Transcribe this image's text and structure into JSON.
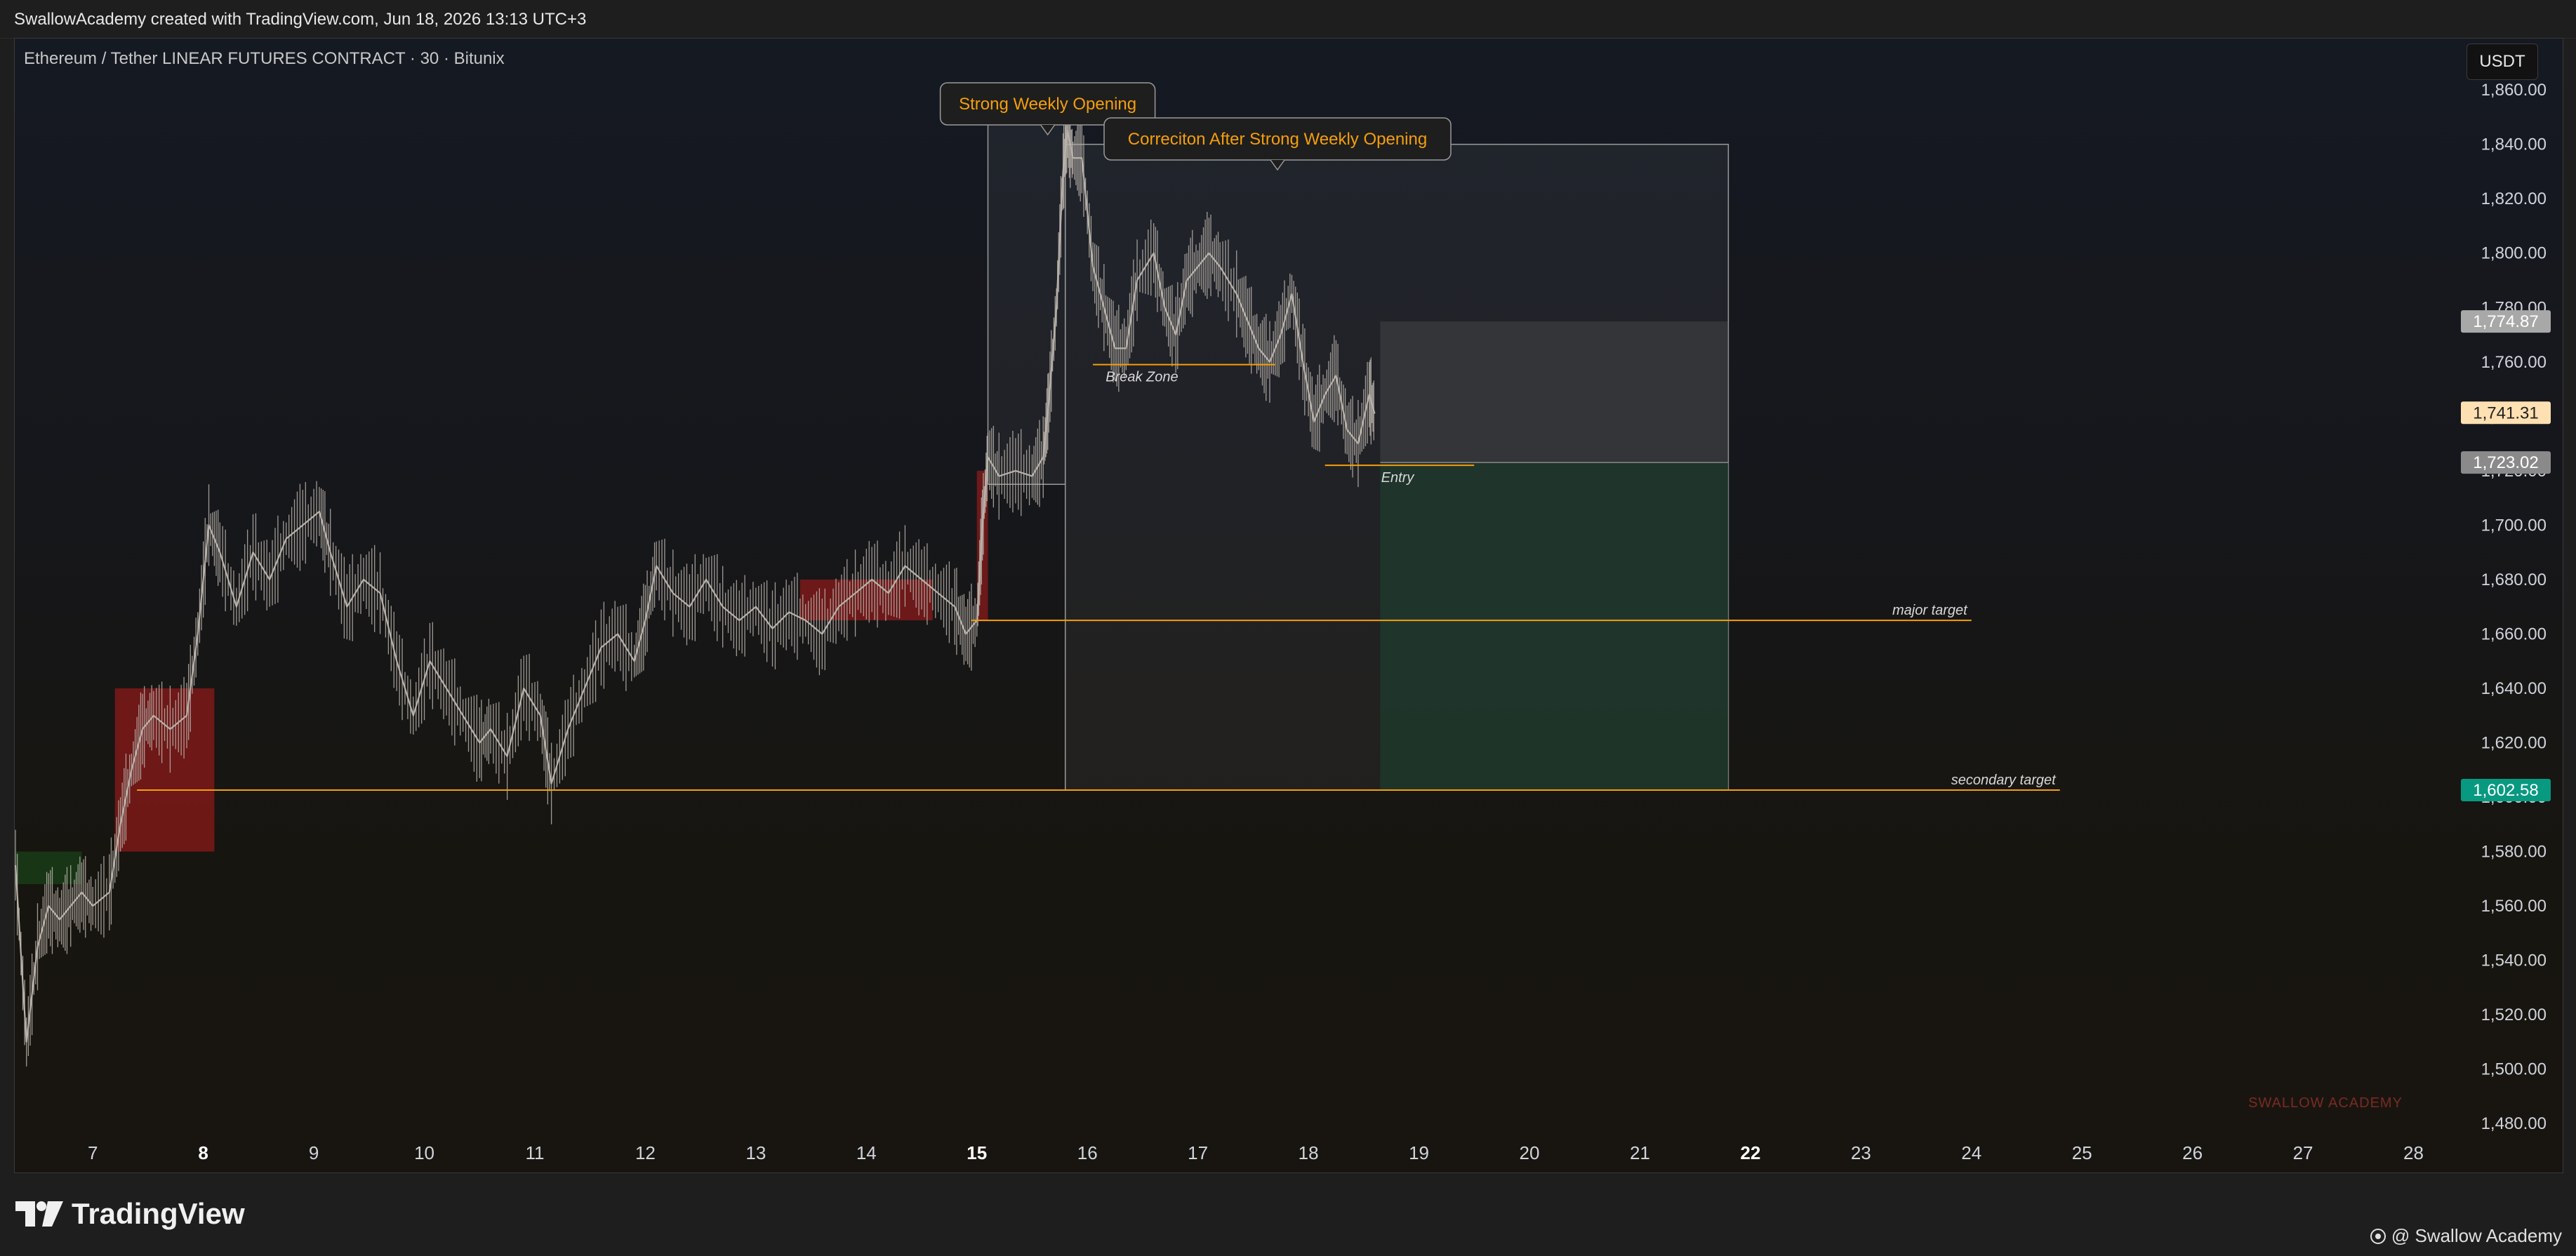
{
  "header": {
    "credit": "SwallowAcademy created with TradingView.com, Jun 18, 2026 13:13 UTC+3",
    "symbol": "Ethereum / Tether LINEAR FUTURES CONTRACT · 30 · Bitunix",
    "currency": "USDT"
  },
  "footer": {
    "logo_text": "TradingView",
    "author": "@ Swallow Academy"
  },
  "chart_data": {
    "type": "candlestick",
    "symbol": "Ethereum / Tether LINEAR FUTURES CONTRACT",
    "timeframe": "30",
    "exchange": "Bitunix",
    "currency": "USDT",
    "ylim": [
      1470,
      1875
    ],
    "y_ticks": [
      1480,
      1500,
      1520,
      1540,
      1560,
      1580,
      1600,
      1620,
      1640,
      1660,
      1680,
      1700,
      1720,
      1740,
      1760,
      1780,
      1800,
      1820,
      1840,
      1860
    ],
    "y_tick_labels": [
      "1,480.00",
      "1,500.00",
      "1,520.00",
      "1,540.00",
      "1,560.00",
      "1,580.00",
      "1,600.00",
      "1,620.00",
      "1,640.00",
      "1,660.00",
      "1,680.00",
      "1,700.00",
      "1,720.00",
      "1,740.00",
      "1,760.00",
      "1,780.00",
      "1,800.00",
      "1,820.00",
      "1,840.00",
      "1,860.00"
    ],
    "xlim": [
      6.3,
      28.2
    ],
    "x_ticks": [
      7,
      8,
      9,
      10,
      11,
      12,
      13,
      14,
      15,
      16,
      17,
      18,
      19,
      20,
      21,
      22,
      23,
      24,
      25,
      26,
      27,
      28
    ],
    "x_tick_labels": [
      "7",
      "8",
      "9",
      "10",
      "11",
      "12",
      "13",
      "14",
      "15",
      "16",
      "17",
      "18",
      "19",
      "20",
      "21",
      "22",
      "23",
      "24",
      "25",
      "26",
      "27",
      "28"
    ],
    "x_bold_ticks": [
      8,
      15,
      22
    ],
    "grid": false,
    "price_path": [
      [
        6.3,
        1575
      ],
      [
        6.4,
        1510
      ],
      [
        6.5,
        1545
      ],
      [
        6.6,
        1560
      ],
      [
        6.7,
        1555
      ],
      [
        6.8,
        1560
      ],
      [
        6.9,
        1565
      ],
      [
        7.0,
        1560
      ],
      [
        7.15,
        1565
      ],
      [
        7.25,
        1590
      ],
      [
        7.35,
        1610
      ],
      [
        7.45,
        1625
      ],
      [
        7.55,
        1630
      ],
      [
        7.7,
        1625
      ],
      [
        7.85,
        1630
      ],
      [
        7.95,
        1660
      ],
      [
        8.05,
        1700
      ],
      [
        8.15,
        1690
      ],
      [
        8.3,
        1670
      ],
      [
        8.45,
        1690
      ],
      [
        8.6,
        1680
      ],
      [
        8.75,
        1695
      ],
      [
        8.9,
        1700
      ],
      [
        9.05,
        1705
      ],
      [
        9.15,
        1690
      ],
      [
        9.3,
        1670
      ],
      [
        9.45,
        1680
      ],
      [
        9.6,
        1675
      ],
      [
        9.75,
        1650
      ],
      [
        9.9,
        1630
      ],
      [
        10.05,
        1650
      ],
      [
        10.2,
        1640
      ],
      [
        10.35,
        1630
      ],
      [
        10.5,
        1620
      ],
      [
        10.6,
        1625
      ],
      [
        10.75,
        1615
      ],
      [
        10.9,
        1640
      ],
      [
        11.05,
        1630
      ],
      [
        11.15,
        1605
      ],
      [
        11.3,
        1625
      ],
      [
        11.45,
        1640
      ],
      [
        11.6,
        1655
      ],
      [
        11.75,
        1660
      ],
      [
        11.9,
        1650
      ],
      [
        12.0,
        1665
      ],
      [
        12.1,
        1685
      ],
      [
        12.25,
        1675
      ],
      [
        12.4,
        1670
      ],
      [
        12.55,
        1680
      ],
      [
        12.7,
        1670
      ],
      [
        12.85,
        1665
      ],
      [
        13.0,
        1670
      ],
      [
        13.15,
        1662
      ],
      [
        13.3,
        1668
      ],
      [
        13.45,
        1665
      ],
      [
        13.6,
        1660
      ],
      [
        13.75,
        1670
      ],
      [
        13.9,
        1675
      ],
      [
        14.05,
        1680
      ],
      [
        14.2,
        1675
      ],
      [
        14.35,
        1685
      ],
      [
        14.5,
        1680
      ],
      [
        14.65,
        1675
      ],
      [
        14.8,
        1670
      ],
      [
        14.9,
        1660
      ],
      [
        15.0,
        1665
      ],
      [
        15.05,
        1700
      ],
      [
        15.1,
        1725
      ],
      [
        15.2,
        1718
      ],
      [
        15.35,
        1720
      ],
      [
        15.5,
        1718
      ],
      [
        15.6,
        1725
      ],
      [
        15.65,
        1745
      ],
      [
        15.72,
        1780
      ],
      [
        15.78,
        1830
      ],
      [
        15.82,
        1845
      ],
      [
        15.87,
        1835
      ],
      [
        15.95,
        1835
      ],
      [
        16.05,
        1795
      ],
      [
        16.15,
        1780
      ],
      [
        16.25,
        1765
      ],
      [
        16.35,
        1765
      ],
      [
        16.45,
        1790
      ],
      [
        16.6,
        1800
      ],
      [
        16.7,
        1780
      ],
      [
        16.8,
        1770
      ],
      [
        16.9,
        1790
      ],
      [
        17.0,
        1795
      ],
      [
        17.1,
        1800
      ],
      [
        17.2,
        1795
      ],
      [
        17.35,
        1785
      ],
      [
        17.45,
        1775
      ],
      [
        17.55,
        1765
      ],
      [
        17.65,
        1760
      ],
      [
        17.75,
        1770
      ],
      [
        17.85,
        1785
      ],
      [
        17.95,
        1760
      ],
      [
        18.05,
        1738
      ],
      [
        18.15,
        1748
      ],
      [
        18.25,
        1755
      ],
      [
        18.35,
        1735
      ],
      [
        18.45,
        1730
      ],
      [
        18.55,
        1748
      ],
      [
        18.6,
        1741
      ]
    ],
    "supply_demand_zones": [
      {
        "color": "green",
        "x": [
          6.3,
          6.9
        ],
        "y": [
          1568,
          1580
        ]
      },
      {
        "color": "red",
        "x": [
          7.2,
          8.1
        ],
        "y": [
          1580,
          1640
        ]
      },
      {
        "color": "red",
        "x": [
          13.4,
          14.6
        ],
        "y": [
          1665,
          1680
        ]
      },
      {
        "color": "red",
        "x": [
          15.0,
          15.1
        ],
        "y": [
          1665,
          1720
        ]
      }
    ],
    "horizontal_levels": [
      {
        "label": "major target",
        "y": 1665,
        "x": [
          14.95,
          24.0
        ]
      },
      {
        "label": "secondary target",
        "y": 1602.58,
        "x": [
          7.4,
          24.8
        ]
      },
      {
        "label": "Break Zone",
        "y": 1759,
        "x": [
          16.05,
          17.7
        ]
      },
      {
        "label": "Entry",
        "y": 1722,
        "x": [
          18.15,
          19.5
        ]
      }
    ],
    "boxes": [
      {
        "label": "Strong Weekly Opening",
        "x": [
          15.1,
          15.8
        ],
        "y": [
          1715,
          1850
        ]
      },
      {
        "label": "Correciton After Strong Weekly Opening",
        "x": [
          15.8,
          21.8
        ],
        "y": [
          1602.58,
          1840
        ]
      }
    ],
    "position_tool": {
      "entry": 1723.02,
      "stop": 1774.87,
      "target": 1602.58,
      "x": [
        18.65,
        21.8
      ]
    },
    "price_labels": [
      {
        "value": "1,774.87",
        "price": 1774.87,
        "color": "#a8a8a8"
      },
      {
        "value": "1,741.31",
        "price": 1741.31,
        "color": "#ffe0b2"
      },
      {
        "value": "1,723.02",
        "price": 1723.02,
        "color": "#8a8a8a"
      },
      {
        "value": "1,602.58",
        "price": 1602.58,
        "color": "#089981"
      }
    ],
    "watermark": "SWALLOW ACADEMY"
  },
  "colors": {
    "candle": "#b8b2aa",
    "level_line": "#f59e0b",
    "annotation_text": "#f59e0b",
    "zone_red": "#b71c1c",
    "zone_green": "#1b5e20",
    "target_fill": "#1f3b2e"
  }
}
